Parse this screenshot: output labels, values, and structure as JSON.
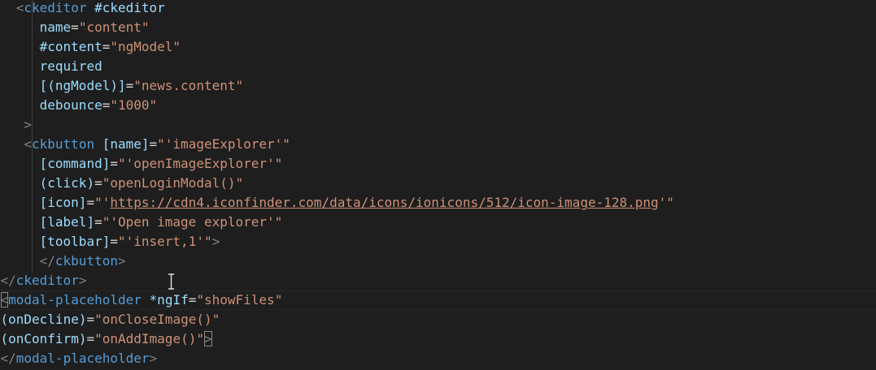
{
  "editor": {
    "language": "html",
    "theme": "dark",
    "lines": [
      {
        "indent": "  ",
        "tokens": [
          {
            "c": "p",
            "v": "<"
          },
          {
            "c": "t",
            "v": "ckeditor"
          },
          {
            "c": "d",
            "v": " "
          },
          {
            "c": "a",
            "v": "#ckeditor"
          }
        ]
      },
      {
        "indent": "     ",
        "tokens": [
          {
            "c": "a",
            "v": "name"
          },
          {
            "c": "d",
            "v": "="
          },
          {
            "c": "s",
            "v": "\"content\""
          }
        ]
      },
      {
        "indent": "     ",
        "tokens": [
          {
            "c": "a",
            "v": "#content"
          },
          {
            "c": "d",
            "v": "="
          },
          {
            "c": "s",
            "v": "\"ngModel\""
          }
        ]
      },
      {
        "indent": "     ",
        "tokens": [
          {
            "c": "a",
            "v": "required"
          }
        ]
      },
      {
        "indent": "     ",
        "tokens": [
          {
            "c": "a",
            "v": "[(ngModel)]"
          },
          {
            "c": "d",
            "v": "="
          },
          {
            "c": "s",
            "v": "\"news.content\""
          }
        ]
      },
      {
        "indent": "     ",
        "tokens": [
          {
            "c": "a",
            "v": "debounce"
          },
          {
            "c": "d",
            "v": "="
          },
          {
            "c": "s",
            "v": "\"1000\""
          }
        ]
      },
      {
        "indent": "   ",
        "tokens": [
          {
            "c": "p",
            "v": ">"
          }
        ]
      },
      {
        "indent": "   ",
        "tokens": [
          {
            "c": "p",
            "v": "<"
          },
          {
            "c": "t",
            "v": "ckbutton"
          },
          {
            "c": "d",
            "v": " "
          },
          {
            "c": "a",
            "v": "[name]"
          },
          {
            "c": "d",
            "v": "="
          },
          {
            "c": "s",
            "v": "\"'imageExplorer'\""
          }
        ]
      },
      {
        "indent": "     ",
        "tokens": [
          {
            "c": "a",
            "v": "[command]"
          },
          {
            "c": "d",
            "v": "="
          },
          {
            "c": "s",
            "v": "\"'openImageExplorer'\""
          }
        ]
      },
      {
        "indent": "     ",
        "tokens": [
          {
            "c": "a",
            "v": "(click)"
          },
          {
            "c": "d",
            "v": "="
          },
          {
            "c": "s",
            "v": "\"openLoginModal()\""
          }
        ]
      },
      {
        "indent": "     ",
        "tokens": [
          {
            "c": "a",
            "v": "[icon]"
          },
          {
            "c": "d",
            "v": "="
          },
          {
            "c": "s",
            "v": "\"'"
          },
          {
            "c": "u",
            "v": "https://cdn4.iconfinder.com/data/icons/ionicons/512/icon-image-128.png"
          },
          {
            "c": "s",
            "v": "'\""
          }
        ]
      },
      {
        "indent": "     ",
        "tokens": [
          {
            "c": "a",
            "v": "[label]"
          },
          {
            "c": "d",
            "v": "="
          },
          {
            "c": "s",
            "v": "\"'Open image explorer'\""
          }
        ]
      },
      {
        "indent": "     ",
        "tokens": [
          {
            "c": "a",
            "v": "[toolbar]"
          },
          {
            "c": "d",
            "v": "="
          },
          {
            "c": "s",
            "v": "\"'insert,1'\""
          },
          {
            "c": "p",
            "v": ">"
          }
        ]
      },
      {
        "indent": "     ",
        "tokens": [
          {
            "c": "p",
            "v": "</"
          },
          {
            "c": "t",
            "v": "ckbutton"
          },
          {
            "c": "p",
            "v": ">"
          }
        ]
      },
      {
        "indent": "",
        "tokens": [
          {
            "c": "p",
            "v": "</"
          },
          {
            "c": "t",
            "v": "ckeditor"
          },
          {
            "c": "p",
            "v": ">"
          }
        ]
      },
      {
        "indent": "",
        "tokens": [
          {
            "c": "pm",
            "v": "<"
          },
          {
            "c": "t",
            "v": "modal-placeholder"
          },
          {
            "c": "d",
            "v": " "
          },
          {
            "c": "a",
            "v": "*ngIf"
          },
          {
            "c": "d",
            "v": "="
          },
          {
            "c": "s",
            "v": "\"showFiles\""
          }
        ]
      },
      {
        "indent": "",
        "tokens": [
          {
            "c": "a",
            "v": "(onDecline)"
          },
          {
            "c": "d",
            "v": "="
          },
          {
            "c": "s",
            "v": "\"onCloseImage()\""
          }
        ]
      },
      {
        "indent": "",
        "tokens": [
          {
            "c": "a",
            "v": "(onConfirm)"
          },
          {
            "c": "d",
            "v": "="
          },
          {
            "c": "s",
            "v": "\"onAddImage()\""
          },
          {
            "c": "pm",
            "v": ">"
          }
        ]
      },
      {
        "indent": "",
        "tokens": [
          {
            "c": "p",
            "v": "</"
          },
          {
            "c": "t",
            "v": "modal-placeholder"
          },
          {
            "c": "p",
            "v": ">"
          }
        ]
      }
    ]
  },
  "colors": {
    "background": "#1e1e1e",
    "punctuation": "#808080",
    "tag": "#569cd6",
    "attribute": "#9cdcfe",
    "string": "#ce9178",
    "default": "#d4d4d4"
  },
  "icons": {
    "text_cursor": "i-beam-cursor-icon"
  }
}
